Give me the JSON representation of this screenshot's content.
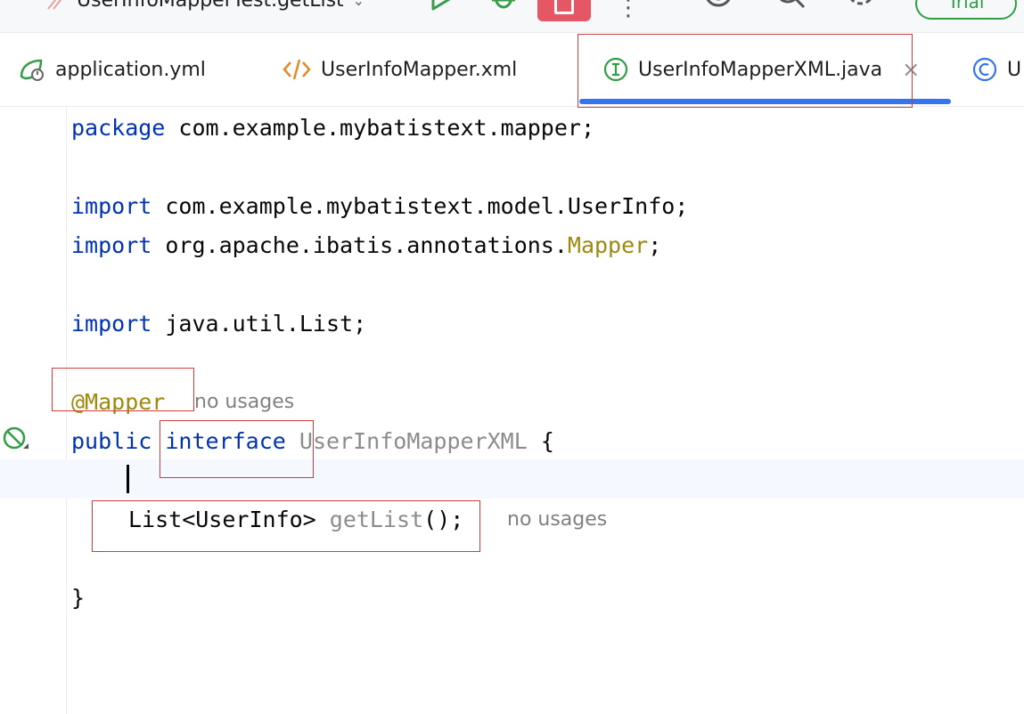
{
  "toolbar": {
    "run_config_label": "UserInfoMapperTest.getList",
    "trial_label": "Trial"
  },
  "tabs": [
    {
      "label": "application.yml",
      "icon": "spring-config-icon"
    },
    {
      "label": "UserInfoMapper.xml",
      "icon": "xml-icon"
    },
    {
      "label": "UserInfoMapperXML.java",
      "icon": "interface-icon",
      "active": true
    },
    {
      "label": "U",
      "icon": "class-icon"
    }
  ],
  "code": {
    "line1_kw": "package",
    "line1_rest": " com.example.mybatistext.mapper;",
    "line3_kw": "import",
    "line3_rest": " com.example.mybatistext.model.UserInfo;",
    "line4_kw": "import",
    "line4_rest": " org.apache.ibatis.annotations.",
    "line4_ann": "Mapper",
    "line4_end": ";",
    "line6_kw": "import",
    "line6_rest": " java.util.List;",
    "line8_ann": "@Mapper",
    "line8_hint": "no usages",
    "line9_kw1": "public",
    "line9_kw2": "interface",
    "line9_name": "UserInfoMapperXML",
    "line9_end": " {",
    "line11_type": "List<UserInfo> ",
    "line11_method": "getList",
    "line11_end": "();",
    "line11_hint": "no usages",
    "line13": "}"
  },
  "colors": {
    "keyword": "#0033b3",
    "annotation": "#9e880d",
    "unused": "#8c8c8c",
    "active_tab_underline": "#3574f0",
    "highlight_box": "#d23c3c"
  }
}
